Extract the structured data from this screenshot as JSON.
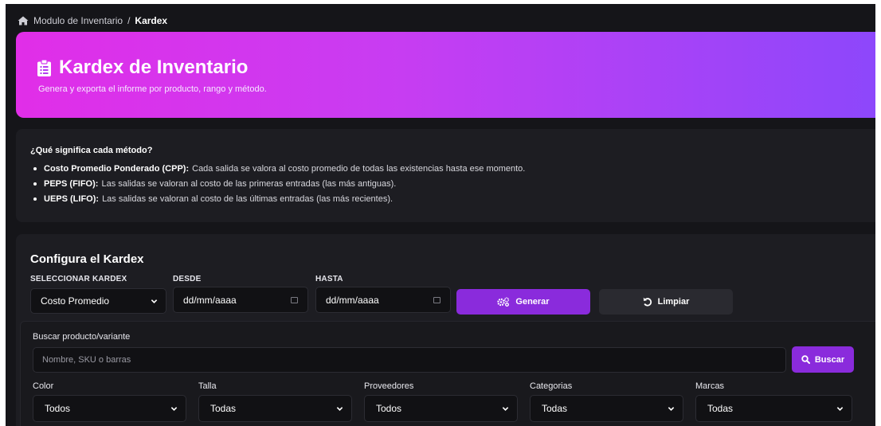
{
  "breadcrumb": {
    "module": "Modulo de Inventario",
    "separator": "/",
    "current": "Kardex"
  },
  "hero": {
    "title": "Kardex de Inventario",
    "subtitle": "Genera y exporta el informe por producto, rango y método."
  },
  "info": {
    "title": "¿Qué significa cada método?",
    "items": [
      {
        "term": "Costo Promedio Ponderado (CPP):",
        "text": "Cada salida se valora al costo promedio de todas las existencias hasta ese momento."
      },
      {
        "term": "PEPS (FIFO):",
        "text": "Las salidas se valoran al costo de las primeras entradas (las más antiguas)."
      },
      {
        "term": "UEPS (LIFO):",
        "text": "Las salidas se valoran al costo de las últimas entradas (las más recientes)."
      }
    ]
  },
  "config": {
    "title": "Configura el Kardex",
    "kardex_label": "SELECCIONAR KARDEX",
    "kardex_value": "Costo Promedio",
    "from_label": "DESDE",
    "from_value": "dd/mm/aaaa",
    "to_label": "HASTA",
    "to_value": "dd/mm/aaaa",
    "generate_label": "Generar",
    "clear_label": "Limpiar"
  },
  "search": {
    "label": "Buscar producto/variante",
    "placeholder": "Nombre, SKU o barras",
    "button_label": "Buscar"
  },
  "filters": [
    {
      "label": "Color",
      "value": "Todos"
    },
    {
      "label": "Talla",
      "value": "Todas"
    },
    {
      "label": "Proveedores",
      "value": "Todos"
    },
    {
      "label": "Categorias",
      "value": "Todas"
    },
    {
      "label": "Marcas",
      "value": "Todas"
    }
  ],
  "colors": {
    "accent": "#8a2bdc",
    "hero_start": "#e12ee8",
    "hero_end": "#8d47fb",
    "background": "#151519"
  }
}
